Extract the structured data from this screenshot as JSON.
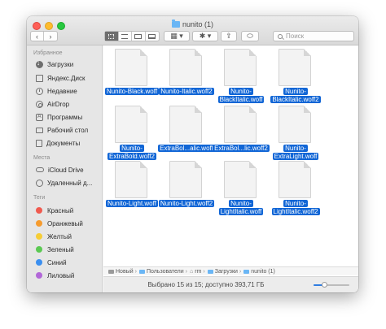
{
  "window": {
    "title": "nunito (1)"
  },
  "toolbar": {
    "back_label": "‹",
    "forward_label": "›",
    "view_icons": [
      "icon-view",
      "list-view",
      "column-view",
      "gallery-view"
    ],
    "group_label": "▦ ▾",
    "action_label": "✱ ▾",
    "share_label": "⇪",
    "tag_label": "⬭",
    "search_placeholder": "Поиск"
  },
  "sidebar": {
    "favorites_header": "Избранное",
    "favorites": [
      {
        "label": "Загрузки",
        "icon": "download-icon"
      },
      {
        "label": "Яндекс.Диск",
        "icon": "disk-icon"
      },
      {
        "label": "Недавние",
        "icon": "clock-icon"
      },
      {
        "label": "AirDrop",
        "icon": "airdrop-icon"
      },
      {
        "label": "Программы",
        "icon": "applications-icon"
      },
      {
        "label": "Рабочий стол",
        "icon": "desktop-icon"
      },
      {
        "label": "Документы",
        "icon": "documents-icon"
      }
    ],
    "places_header": "Места",
    "places": [
      {
        "label": "iCloud Drive",
        "icon": "cloud-icon"
      },
      {
        "label": "Удаленный д...",
        "icon": "remote-disk-icon"
      }
    ],
    "tags_header": "Теги",
    "tags": [
      {
        "label": "Красный",
        "color": "#f05a4f"
      },
      {
        "label": "Оранжевый",
        "color": "#f69b2e"
      },
      {
        "label": "Желтый",
        "color": "#f6cd36"
      },
      {
        "label": "Зеленый",
        "color": "#5bc953"
      },
      {
        "label": "Синий",
        "color": "#3b8ff0"
      },
      {
        "label": "Лиловый",
        "color": "#b268d8"
      }
    ]
  },
  "files": [
    {
      "name": "Nunito-Black.woff"
    },
    {
      "name": "Nunito-Italic.woff2"
    },
    {
      "name": "Nunito-BlackItalic.woff"
    },
    {
      "name": "Nunito-BlackItalic.woff2"
    },
    {
      "name": "Nunito-ExtraBold.woff2"
    },
    {
      "name": "ExtraBol...alic.woff"
    },
    {
      "name": "ExtraBol...lic.woff2"
    },
    {
      "name": "Nunito-ExtraLight.woff"
    },
    {
      "name": "Nunito-Light.woff"
    },
    {
      "name": "Nunito-Light.woff2"
    },
    {
      "name": "Nunito-LightItalic.woff"
    },
    {
      "name": "Nunito-LightItalic.woff2"
    }
  ],
  "pathbar": {
    "items": [
      "Новый",
      "Пользователи",
      "rm",
      "Загрузки",
      "nunito (1)"
    ]
  },
  "status": {
    "text": "Выбрано 15 из 15; доступно 393,71 ГБ",
    "zoom_level": 0.3
  }
}
